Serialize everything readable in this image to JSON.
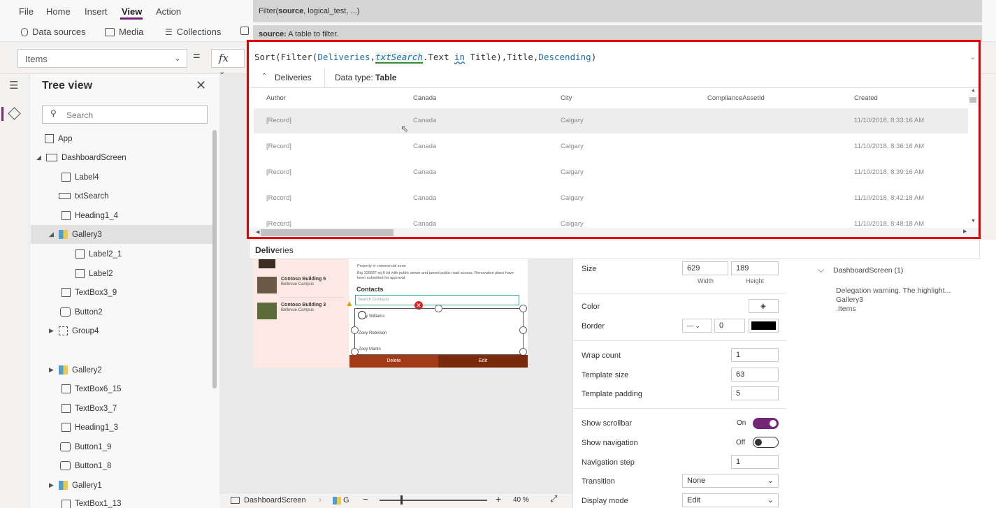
{
  "menu": {
    "items": [
      "File",
      "Home",
      "Insert",
      "View",
      "Action"
    ]
  },
  "ribbon": {
    "items": [
      "Data sources",
      "Media",
      "Collections"
    ]
  },
  "tooltip": {
    "signature_pre": "Filter(",
    "signature_bold": "source",
    "signature_post": ", logical_test, ...)",
    "param_bold": "source:",
    "param_desc": " A table to filter."
  },
  "formula": {
    "property": "Items",
    "eq": "=",
    "fx": "fx",
    "parts": {
      "p1": "Sort(Filter(",
      "p2": "Deliveries",
      "p3": ",",
      "p4": "txtSearch",
      "p5": ".Text ",
      "p6": "in",
      "p7": " Title),Title,",
      "p8": "Descending",
      "p9": ")"
    }
  },
  "datatable": {
    "source": "Deliveries",
    "dtype_label": "Data type: ",
    "dtype_value": "Table",
    "columns": [
      "Author",
      "Canada",
      "City",
      "ComplianceAssetId",
      "Created"
    ],
    "rows": [
      [
        "[Record]",
        "Canada",
        "Calgary",
        "",
        "11/10/2018, 8:33:16 AM"
      ],
      [
        "[Record]",
        "Canada",
        "Calgary",
        "",
        "11/10/2018, 8:36:16 AM"
      ],
      [
        "[Record]",
        "Canada",
        "Calgary",
        "",
        "11/10/2018, 8:39:16 AM"
      ],
      [
        "[Record]",
        "Canada",
        "Calgary",
        "",
        "11/10/2018, 8:42:18 AM"
      ],
      [
        "[Record]",
        "Canada",
        "Calgary",
        "",
        "11/10/2018, 8:48:18 AM"
      ]
    ]
  },
  "suggest": {
    "bold": "Deliv",
    "rest": "eries"
  },
  "tree": {
    "title": "Tree view",
    "search_placeholder": "Search",
    "items": [
      "App",
      "DashboardScreen",
      "Label4",
      "txtSearch",
      "Heading1_4",
      "Gallery3",
      "Label2_1",
      "Label2",
      "TextBox3_9",
      "Button2",
      "Group4",
      "Gallery2",
      "TextBox6_15",
      "TextBox3_7",
      "Heading1_3",
      "Button1_9",
      "Button1_8",
      "Gallery1",
      "TextBox1_13"
    ]
  },
  "canvas": {
    "cards": [
      {
        "title": "Contoso Building 5",
        "sub": "Bellevue Campus"
      },
      {
        "title": "Contoso Building 3",
        "sub": "Bellevue Campus"
      }
    ],
    "desc1": "Property in commercial zone",
    "desc2": "Big 106687 sq ft lot with public sewer and paved public road access. Renovation plans have been submitted for approval.",
    "contacts_title": "Contacts",
    "contacts_search": "Search Contacts",
    "contacts": [
      "Zoey Williams",
      "Zoey Robinson",
      "Zoey Martin"
    ],
    "delete_label": "Delete",
    "edit_label": "Edit"
  },
  "bottom": {
    "screen": "DashboardScreen",
    "gallery": "G",
    "zoom": "40",
    "zoom_unit": "%"
  },
  "props": {
    "size_label": "Size",
    "width": "629",
    "height": "189",
    "width_label": "Width",
    "height_label": "Height",
    "color_label": "Color",
    "border_label": "Border",
    "border_width": "0",
    "wrap_label": "Wrap count",
    "wrap": "1",
    "tsize_label": "Template size",
    "tsize": "63",
    "tpad_label": "Template padding",
    "tpad": "5",
    "scrollbar_label": "Show scrollbar",
    "scrollbar_state": "On",
    "nav_label": "Show navigation",
    "nav_state": "Off",
    "navstep_label": "Navigation step",
    "navstep": "1",
    "transition_label": "Transition",
    "transition": "None",
    "display_label": "Display mode",
    "display": "Edit"
  },
  "right": {
    "screen": "DashboardScreen (1)",
    "warning": "Delegation warning. The highlight...",
    "line2": "Gallery3",
    "line3": ".Items"
  },
  "colors": {
    "accent": "#742774",
    "highlight": "#e00000",
    "keyword": "#1b6fb5"
  }
}
